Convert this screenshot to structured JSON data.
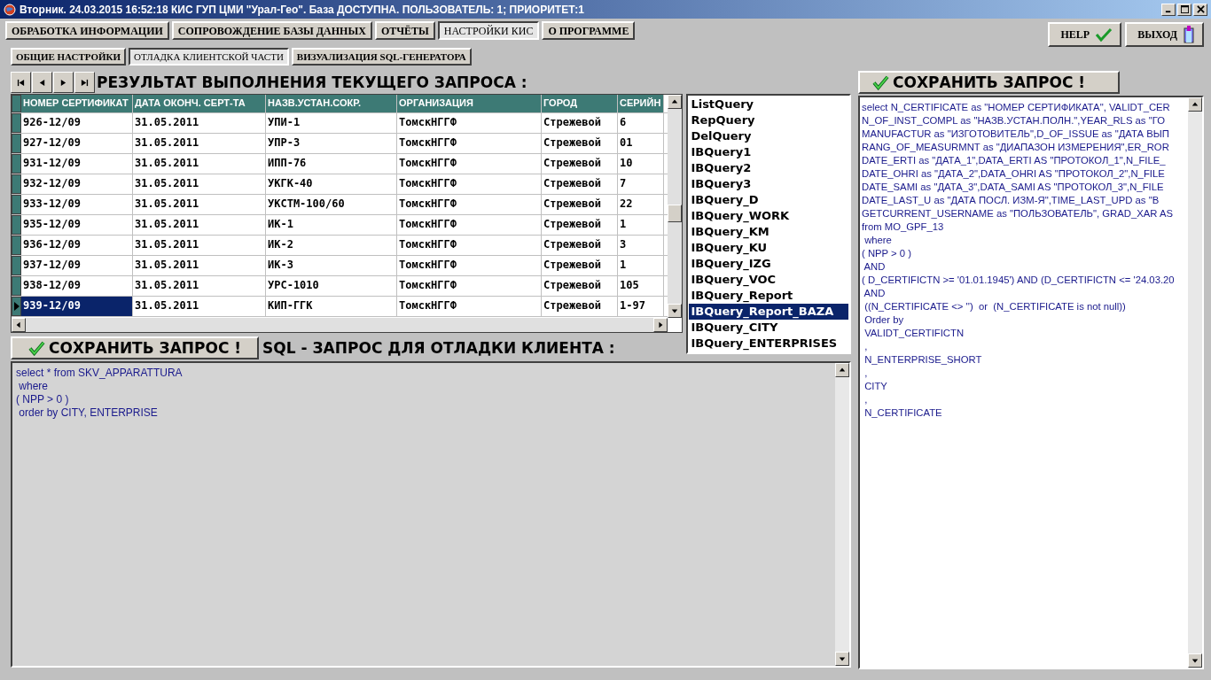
{
  "window": {
    "title": "Вторник. 24.03.2015 16:52:18 КИС ГУП ЦМИ \"Урал-Гео\". База ДОСТУПНА. ПОЛЬЗОВАТЕЛЬ: 1; ПРИОРИТЕТ:1"
  },
  "menu_tabs": [
    {
      "label": "ОБРАБОТКА ИНФОРМАЦИИ",
      "selected": false
    },
    {
      "label": "СОПРОВОЖДЕНИЕ БАЗЫ ДАННЫХ",
      "selected": false
    },
    {
      "label": "ОТЧЁТЫ",
      "selected": false
    },
    {
      "label": "НАСТРОЙКИ КИС",
      "selected": true
    },
    {
      "label": "О ПРОГРАММЕ",
      "selected": false
    }
  ],
  "help_button": {
    "label": "HELP"
  },
  "exit_button": {
    "label": "ВЫХОД"
  },
  "sub_tabs": [
    {
      "label": "ОБЩИЕ НАСТРОЙКИ",
      "selected": false
    },
    {
      "label": "ОТЛАДКА КЛИЕНТСКОЙ ЧАСТИ",
      "selected": true
    },
    {
      "label": "ВИЗУАЛИЗАЦИЯ SQL-ГЕНЕРАТОРА",
      "selected": false
    }
  ],
  "result_heading": "РЕЗУЛЬТАТ ВЫПОЛНЕНИЯ ТЕКУЩЕГО ЗАПРОСА :",
  "table": {
    "columns": [
      "НОМЕР СЕРТИФИКАТ",
      "ДАТА ОКОНЧ. СЕРТ-ТА",
      "НАЗВ.УСТАН.СОКР.",
      "ОРГАНИЗАЦИЯ",
      "ГОРОД",
      "СЕРИЙН"
    ],
    "rows": [
      {
        "cells": [
          "926-12/09",
          "31.05.2011",
          "УПИ-1",
          "ТомскНГГФ",
          "Стрежевой",
          "6"
        ],
        "selected": false
      },
      {
        "cells": [
          "927-12/09",
          "31.05.2011",
          "УПР-3",
          "ТомскНГГФ",
          "Стрежевой",
          "01"
        ],
        "selected": false
      },
      {
        "cells": [
          "931-12/09",
          "31.05.2011",
          "ИПП-76",
          "ТомскНГГФ",
          "Стрежевой",
          "10"
        ],
        "selected": false
      },
      {
        "cells": [
          "932-12/09",
          "31.05.2011",
          "УКГК-40",
          "ТомскНГГФ",
          "Стрежевой",
          "7"
        ],
        "selected": false
      },
      {
        "cells": [
          "933-12/09",
          "31.05.2011",
          "УКСТМ-100/60",
          "ТомскНГГФ",
          "Стрежевой",
          "22"
        ],
        "selected": false
      },
      {
        "cells": [
          "935-12/09",
          "31.05.2011",
          "ИК-1",
          "ТомскНГГФ",
          "Стрежевой",
          "1"
        ],
        "selected": false
      },
      {
        "cells": [
          "936-12/09",
          "31.05.2011",
          "ИК-2",
          "ТомскНГГФ",
          "Стрежевой",
          "3"
        ],
        "selected": false
      },
      {
        "cells": [
          "937-12/09",
          "31.05.2011",
          "ИК-3",
          "ТомскНГГФ",
          "Стрежевой",
          "1"
        ],
        "selected": false
      },
      {
        "cells": [
          "938-12/09",
          "31.05.2011",
          "УРС-1010",
          "ТомскНГГФ",
          "Стрежевой",
          "105"
        ],
        "selected": false
      },
      {
        "cells": [
          "939-12/09",
          "31.05.2011",
          "КИП-ГГК",
          "ТомскНГГФ",
          "Стрежевой",
          "1-97"
        ],
        "selected": true
      }
    ]
  },
  "query_list": [
    {
      "label": "ListQuery",
      "selected": false
    },
    {
      "label": "RepQuery",
      "selected": false
    },
    {
      "label": "DelQuery",
      "selected": false
    },
    {
      "label": "IBQuery1",
      "selected": false
    },
    {
      "label": "IBQuery2",
      "selected": false
    },
    {
      "label": "IBQuery3",
      "selected": false
    },
    {
      "label": "IBQuery_D",
      "selected": false
    },
    {
      "label": "IBQuery_WORK",
      "selected": false
    },
    {
      "label": "IBQuery_KM",
      "selected": false
    },
    {
      "label": "IBQuery_KU",
      "selected": false
    },
    {
      "label": "IBQuery_IZG",
      "selected": false
    },
    {
      "label": "IBQuery_VOC",
      "selected": false
    },
    {
      "label": "IBQuery_Report",
      "selected": false
    },
    {
      "label": "IBQuery_Report_BAZA",
      "selected": true
    },
    {
      "label": "IBQuery_CITY",
      "selected": false
    },
    {
      "label": "IBQuery_ENTERPRISES",
      "selected": false
    }
  ],
  "save_button_left": {
    "label": "СОХРАНИТЬ ЗАПРОС !"
  },
  "sql_heading": "SQL - ЗАПРОС ДЛЯ ОТЛАДКИ КЛИЕНТА :",
  "client_sql": "select * from SKV_APPARATTURA\n where\n( NPP > 0 )\n order by CITY, ENTERPRISE",
  "save_button_right": {
    "label": "СОХРАНИТЬ ЗАПРОС !"
  },
  "generated_sql": "select N_CERTIFICATE as \"НОМЕР СЕРТИФИКАТА\", VALIDT_CER\nN_OF_INST_COMPL as \"НАЗВ.УСТАН.ПОЛН.\",YEAR_RLS as \"ГО\nMANUFACTUR as \"ИЗГОТОВИТЕЛЬ\",D_OF_ISSUE as \"ДАТА ВЫП\nRANG_OF_MEASURMNT as \"ДИАПАЗОН ИЗМЕРЕНИЯ\",ER_ROR\nDATE_ERTI as \"ДАТА_1\",DATA_ERTI AS \"ПРОТОКОЛ_1\",N_FILE_\nDATE_OHRI as \"ДАТА_2\",DATA_OHRI AS \"ПРОТОКОЛ_2\",N_FILE\nDATE_SAMI as \"ДАТА_3\",DATA_SAMI AS \"ПРОТОКОЛ_3\",N_FILE\nDATE_LAST_U as \"ДАТА ПОСЛ. ИЗМ-Я\",TIME_LAST_UPD as \"В\nGETCURRENT_USERNAME as \"ПОЛЬЗОВАТЕЛЬ\", GRAD_XAR AS\nfrom MO_GPF_13\n where\n( NPP > 0 )\n AND\n( D_CERTIFICTN >= '01.01.1945') AND (D_CERTIFICTN <= '24.03.20\n AND\n ((N_CERTIFICATE <> '')  or  (N_CERTIFICATE is not null))\n Order by\n VALIDT_CERTIFICTN\n ,\n N_ENTERPRISE_SHORT\n ,\n CITY\n ,\n N_CERTIFICATE"
}
